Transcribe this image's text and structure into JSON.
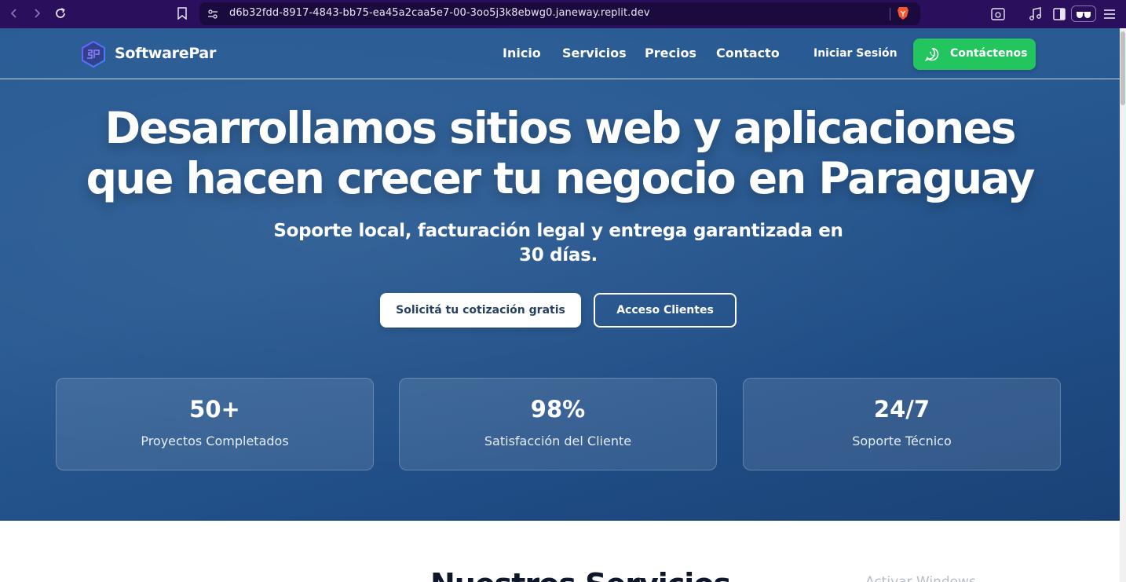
{
  "browser": {
    "url": "d6b32fdd-8917-4843-bb75-ea45a2caa5e7-00-3oo5j3k8ebwg0.janeway.replit.dev",
    "icons": [
      "back-icon",
      "forward-icon",
      "reload-icon",
      "bookmark-icon",
      "site-settings-icon",
      "brave-shield-icon",
      "screenshot-icon",
      "music-icon",
      "sidebar-icon",
      "glasses-icon",
      "menu-icon"
    ]
  },
  "nav": {
    "brand": "SoftwarePar",
    "links": [
      "Inicio",
      "Servicios",
      "Precios",
      "Contacto"
    ],
    "login": "Iniciar Sesión",
    "cta": "Contáctenos"
  },
  "hero": {
    "title_line1": "Desarrollamos sitios web y aplicaciones",
    "title_line2": "que hacen crecer tu negocio en Paraguay",
    "subtitle": "Soporte local, facturación legal y entrega garantizada en 30 días.",
    "primary_button": "Solicitá tu cotización gratis",
    "secondary_button": "Acceso Clientes"
  },
  "stats": [
    {
      "value": "50+",
      "label": "Proyectos Completados"
    },
    {
      "value": "98%",
      "label": "Satisfacción del Cliente"
    },
    {
      "value": "24/7",
      "label": "Soporte Técnico"
    }
  ],
  "services": {
    "title": "Nuestros Servicios"
  },
  "watermark": "Activar Windows",
  "colors": {
    "browser_bar": "#2a0f5c",
    "hero_bg": "#295a92",
    "cta_green": "#22c55e",
    "primary_text": "#1e3a5f"
  }
}
